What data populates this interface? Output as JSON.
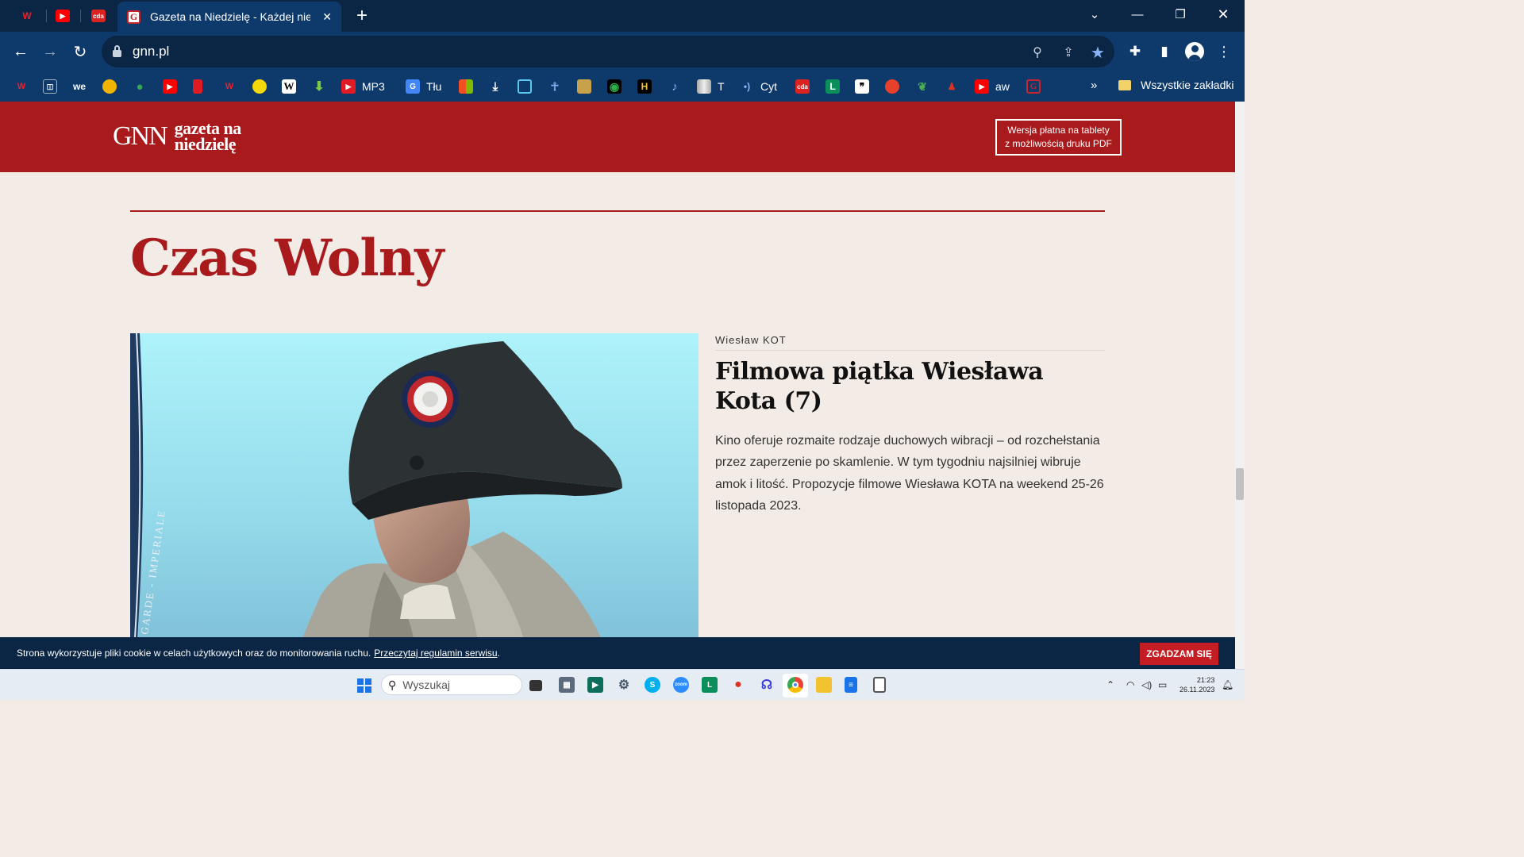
{
  "browser": {
    "active_tab_title": "Gazeta na Niedzielę - Każdej niedzieli",
    "url": "gnn.pl",
    "all_bookmarks_label": "Wszystkie zakładki",
    "bookmark_labels": {
      "mp3": "MP3",
      "tlu": "Tłu",
      "t": "T",
      "cyt": "Cyt",
      "aw": "aw"
    },
    "pinned_tabs": [
      "wp",
      "youtube",
      "cda"
    ]
  },
  "site": {
    "logo_mark": "GNN",
    "logo_line1": "gazeta na",
    "logo_line2": "niedzielę",
    "pdf_button_line1": "Wersja płatna na tablety",
    "pdf_button_line2": "z możliwością druku PDF",
    "accent_color": "#a81a1c"
  },
  "section": {
    "title": "Czas Wolny"
  },
  "article": {
    "author": "Wiesław KOT",
    "headline": "Filmowa piątka Wiesława Kota (7)",
    "lead": "Kino oferuje rozmaite rodzaje duchowych wibracji – od rozchełstania przez zaperzenie po skamlenie. W tym tygodniu najsilniej wibruje amok i litość. Propozycje filmowe Wiesława KOTA na weekend 25-26 listopada 2023.",
    "image_caption_text": "GARDE - IMPERIALE"
  },
  "cookie_bar": {
    "text": "Strona wykorzystuje pliki cookie w celach użytkowych oraz do monitorowania ruchu.",
    "link_text": "Przeczytaj regulamin serwisu",
    "suffix": ".",
    "button": "ZGADZAM SIĘ"
  },
  "taskbar": {
    "search_placeholder": "Wyszukaj",
    "time": "21:23",
    "date": "26.11.2023"
  }
}
